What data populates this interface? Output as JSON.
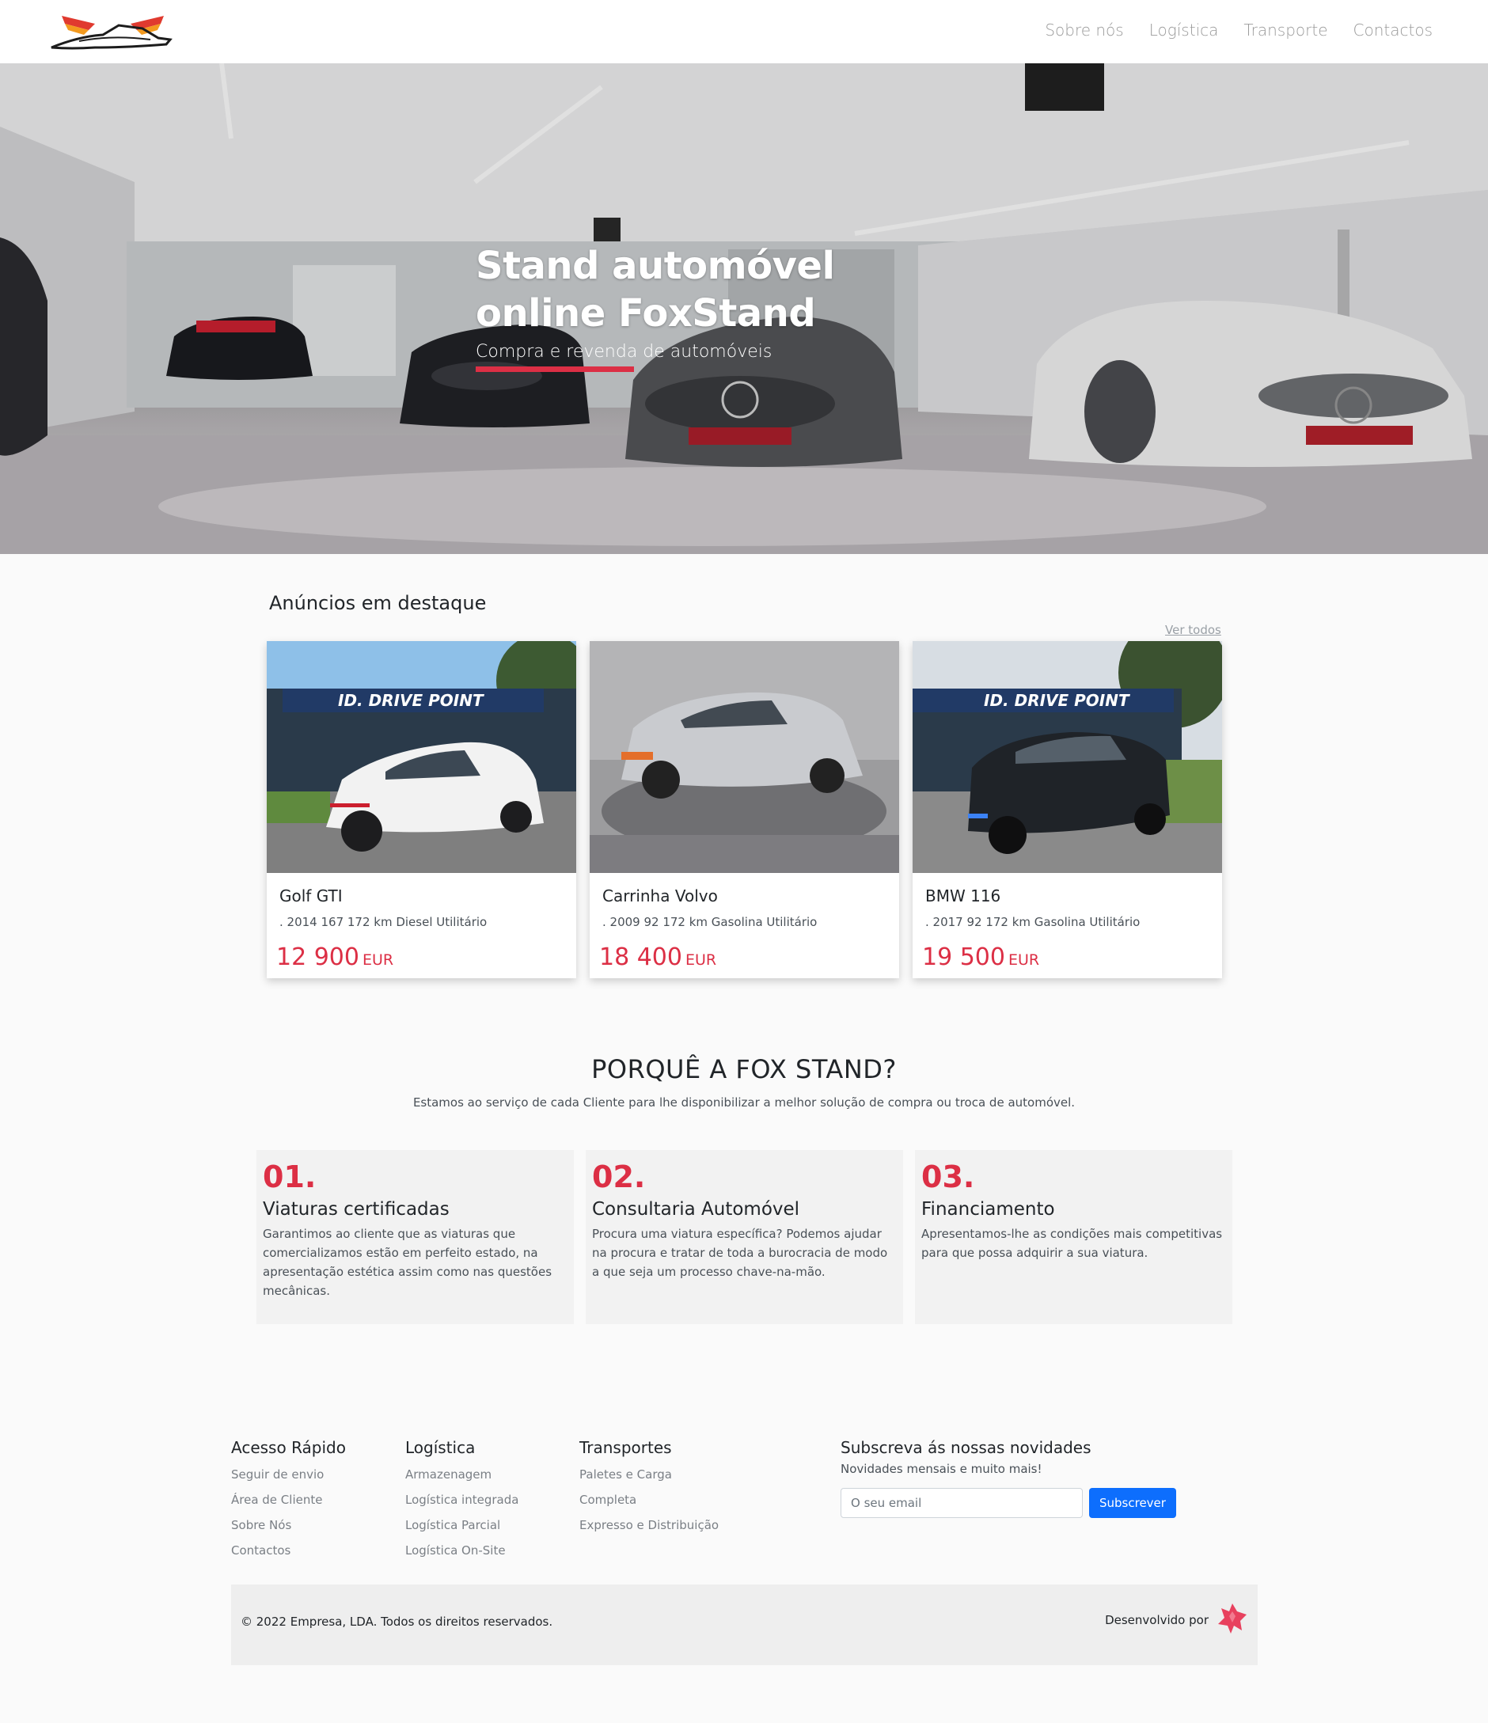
{
  "nav": {
    "logo_icon": "winged-car-logo",
    "links": [
      "Sobre nós",
      "Logística",
      "Transporte",
      "Contactos"
    ]
  },
  "hero": {
    "title": "Stand automóvel online FoxStand",
    "subtitle": "Compra e revenda de automóveis",
    "accent_color": "#dc2f45"
  },
  "featured": {
    "title": "Anúncios em destaque",
    "see_all": "Ver todos",
    "cards": [
      {
        "title": "Golf GTI",
        "info": ". 2014 167 172 km Diesel Utilitário",
        "price": "12 900",
        "currency": "EUR",
        "car_color": "#f2f2f2"
      },
      {
        "title": "Carrinha Volvo",
        "info": ". 2009 92 172 km Gasolina Utilitário",
        "price": "18 400",
        "currency": "EUR",
        "car_color": "#c9cbcf"
      },
      {
        "title": "BMW 116",
        "info": ". 2017 92 172 km Gasolina Utilitário",
        "price": "19 500",
        "currency": "EUR",
        "car_color": "#1f2328"
      }
    ]
  },
  "why": {
    "title": "PORQUÊ A FOX STAND?",
    "subtitle": "Estamos ao serviço de cada Cliente para lhe disponibilizar a melhor solução de compra ou troca de automóvel.",
    "items": [
      {
        "num": "01.",
        "title": "Viaturas certificadas",
        "text": "Garantimos ao cliente que as viaturas que comercializamos estão em perfeito estado, na apresentação estética assim como nas questões mecânicas."
      },
      {
        "num": "02.",
        "title": "Consultaria Automóvel",
        "text": "Procura uma viatura específica? Podemos ajudar na procura e tratar de toda a burocracia de modo a que seja um processo chave-na-mão."
      },
      {
        "num": "03.",
        "title": "Financiamento",
        "text": "Apresentamos-lhe as condições mais competitivas para que possa adquirir a sua viatura."
      }
    ]
  },
  "footer": {
    "cols": [
      {
        "title": "Acesso Rápido",
        "links": [
          "Seguir de envio",
          "Área de Cliente",
          "Sobre Nós",
          "Contactos"
        ]
      },
      {
        "title": "Logística",
        "links": [
          "Armazenagem",
          "Logística integrada",
          "Logística Parcial",
          "Logística On-Site"
        ]
      },
      {
        "title": "Transportes",
        "links": [
          "Paletes e Carga",
          "Completa",
          "Expresso e Distribuição"
        ]
      }
    ],
    "newsletter": {
      "title": "Subscreva ás nossas novidades",
      "subtitle": "Novidades mensais e muito mais!",
      "placeholder": "O seu email",
      "button": "Subscrever"
    },
    "copyright": "© 2022 Empresa, LDA. Todos os direitos reservados.",
    "dev_by": "Desenvolvido por",
    "dev_icon": "fox-head-icon"
  }
}
